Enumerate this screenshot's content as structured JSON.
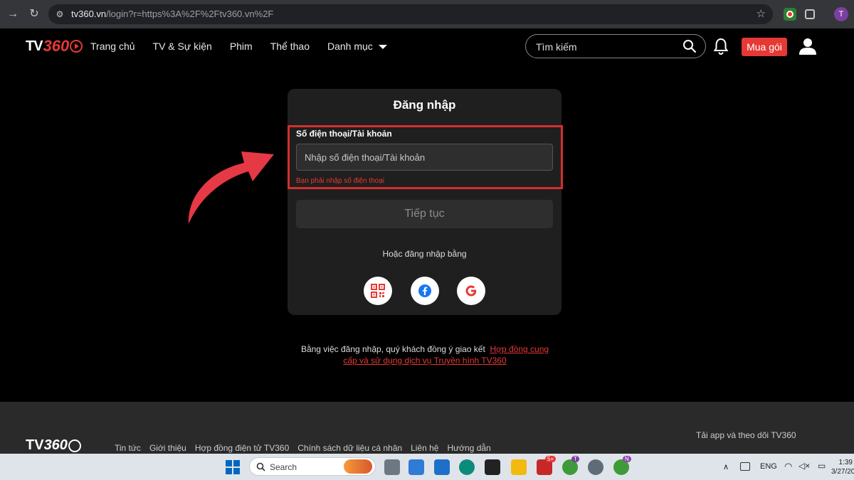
{
  "browser": {
    "url_host": "tv360.vn",
    "url_rest": "/login?r=https%3A%2F%2Ftv360.vn%2F",
    "profile_initial": "T"
  },
  "header": {
    "logo_text": "TV",
    "logo_num": "360",
    "nav": [
      "Trang chủ",
      "TV & Sự kiện",
      "Phim",
      "Thể thao",
      "Danh mục"
    ],
    "search_placeholder": "Tìm kiếm",
    "buy_label": "Mua gói"
  },
  "login": {
    "title": "Đăng nhập",
    "field_label": "Số điện thoại/Tài khoản",
    "field_placeholder": "Nhập số điện thoại/Tài khoản",
    "field_error": "Bạn phải nhập số điện thoại",
    "continue_label": "Tiếp tục",
    "or_text": "Hoặc đăng nhập bằng",
    "social": [
      "qr-code",
      "facebook",
      "google"
    ],
    "terms_prefix": "Bằng việc đăng nhập, quý khách đồng ý giao kết",
    "terms_link": "Hợp đồng cung cấp và sử dụng dịch vụ Truyền hình TV360"
  },
  "footer": {
    "logo_text": "TV",
    "logo_num": "360",
    "links": [
      "Tin tức",
      "Giới thiệu",
      "Hợp đồng điện tử TV360",
      "Chính sách dữ liệu cá nhân",
      "Liên hệ",
      "Hướng dẫn"
    ],
    "app_text": "Tải app và theo dõi TV360"
  },
  "taskbar": {
    "search_label": "Search",
    "lang": "ENG",
    "time": "1:39",
    "date": "3/27/20",
    "zalo_badge": "5+",
    "chrome_badge": "T",
    "chrome2_badge": "N"
  },
  "colors": {
    "accent": "#e53935",
    "card_bg": "#1f1f1f",
    "footer_bg": "#2a2a2a"
  }
}
